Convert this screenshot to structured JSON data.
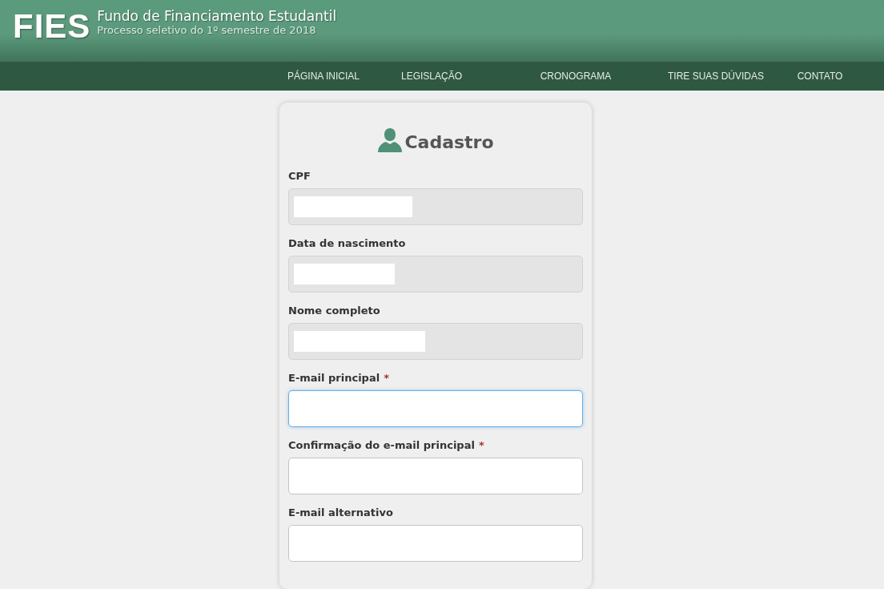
{
  "header": {
    "logo": "FIES",
    "title": "Fundo de Financiamento Estudantil",
    "subtitle": "Processo seletivo do 1º semestre de 2018"
  },
  "nav": [
    {
      "label": "PÁGINA INICIAL"
    },
    {
      "label": "LEGISLAÇÃO"
    },
    {
      "label": "CRONOGRAMA"
    },
    {
      "label": "TIRE SUAS DÚVIDAS"
    },
    {
      "label": "CONTATO"
    }
  ],
  "form": {
    "title": "Cadastro",
    "fields": [
      {
        "label": "CPF",
        "disabled": true,
        "redacted": true,
        "focused": false
      },
      {
        "label": "Data de nascimento",
        "disabled": true,
        "redacted": true,
        "focused": false
      },
      {
        "label": "Nome completo",
        "disabled": true,
        "redacted": true,
        "focused": false
      },
      {
        "label": "E-mail principal",
        "required_mark": "*",
        "disabled": false,
        "focused": true
      },
      {
        "label": "Confirmação do e-mail principal",
        "required_mark": "*",
        "disabled": false,
        "focused": false
      },
      {
        "label": "E-mail alternativo",
        "disabled": false,
        "focused": false
      }
    ]
  }
}
